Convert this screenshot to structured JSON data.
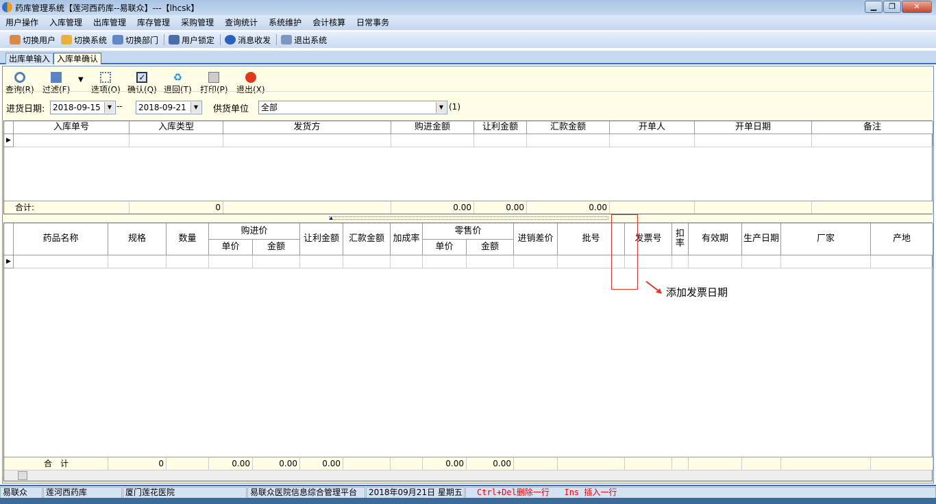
{
  "window": {
    "title": "药库管理系统【莲河西药库--易联众】---【lhcsk】",
    "controls": [
      "minimize",
      "restore",
      "close"
    ]
  },
  "menu": [
    "用户操作",
    "入库管理",
    "出库管理",
    "库存管理",
    "采购管理",
    "查询统计",
    "系统维护",
    "会计核算",
    "日常事务"
  ],
  "toolbar": [
    {
      "label": "切换用户",
      "icon": "switch-user-icon"
    },
    {
      "label": "切换系统",
      "icon": "switch-system-icon"
    },
    {
      "label": "切换部门",
      "icon": "switch-dept-icon"
    },
    {
      "label": "用户锁定",
      "icon": "user-lock-icon"
    },
    {
      "label": "消息收发",
      "icon": "message-icon"
    },
    {
      "label": "退出系统",
      "icon": "exit-system-icon"
    }
  ],
  "tabs": [
    {
      "label": "出库单输入",
      "active": false
    },
    {
      "label": "入库单确认",
      "active": true
    }
  ],
  "actions": [
    {
      "label": "查询(R)",
      "icon": "refresh-icon"
    },
    {
      "label": "过滤(F)",
      "icon": "filter-icon"
    },
    {
      "label": "选项(O)",
      "icon": "options-icon"
    },
    {
      "label": "确认(Q)",
      "icon": "checkbox-icon"
    },
    {
      "label": "退回(T)",
      "icon": "recycle-icon"
    },
    {
      "label": "打印(P)",
      "icon": "printer-icon"
    },
    {
      "label": "退出(X)",
      "icon": "power-icon"
    }
  ],
  "filter": {
    "date_label": "进货日期:",
    "date_from": "2018-09-15",
    "sep": "--",
    "date_to": "2018-09-21",
    "supplier_label": "供货单位",
    "supplier": "全部",
    "extra": "(1)"
  },
  "top_grid": {
    "columns": [
      "入库单号",
      "入库类型",
      "发货方",
      "购进金额",
      "让利金额",
      "汇款金额",
      "开单人",
      "开单日期",
      "备注"
    ],
    "totals_label": "合计:",
    "totals": [
      "",
      "0",
      "",
      "0.00",
      "0.00",
      "0.00",
      "",
      "",
      ""
    ]
  },
  "bottom_grid": {
    "columns": [
      "药品名称",
      "规格",
      "数量",
      "单价",
      "金额",
      "让利金额",
      "汇款金额",
      "加成率",
      "单价",
      "金额",
      "进销差价",
      "批号",
      "发票号",
      "扣率",
      "有效期",
      "生产日期",
      "厂家",
      "产地"
    ],
    "group_headers": {
      "purchase": "购进价",
      "retail": "零售价"
    },
    "totals_label": "合　计",
    "totals": [
      "",
      "0",
      "",
      "0.00",
      "0.00",
      "0.00",
      "",
      "",
      "0.00",
      "0.00",
      "",
      "",
      "",
      "",
      "",
      "",
      "",
      ""
    ]
  },
  "annotation": {
    "text": "添加发票日期",
    "color": "#e8322a"
  },
  "status": [
    "易联众",
    "莲河西药库",
    "厦门莲花医院",
    "易联众医院信息综合管理平台",
    "2018年09月21日 星期五",
    "Ctrl+Del删除一行   Ins 插入一行"
  ]
}
